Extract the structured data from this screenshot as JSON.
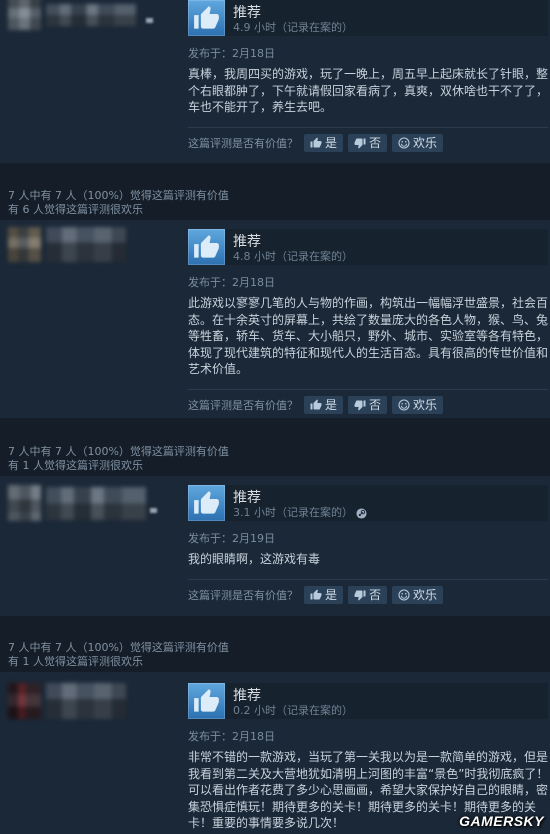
{
  "reviews": [
    {
      "recommendation": "推荐",
      "hours": "4.9 小时（记录在案的）",
      "posted": "发布于：2月18日",
      "body_lines": [
        "真棒，我周四买的游戏，玩了一晚上，周五早上起床就长了针眼，整",
        "个右眼都肿了，下午就请假回家看病了，真爽，双休啥也干不了了，",
        "车也不能开了，养生去吧。"
      ],
      "feedback": {
        "prompt": "这篇评测是否有价值？",
        "yes": "是",
        "no": "否",
        "funny": "欢乐"
      }
    },
    {
      "header": {
        "helpful": "7 人中有 7 人（100%）觉得这篇评测有价值",
        "funny": "有 6 人觉得这篇评测很欢乐"
      },
      "recommendation": "推荐",
      "hours": "4.8 小时（记录在案的）",
      "posted": "发布于：2月18日",
      "body_lines": [
        "此游戏以寥寥几笔的人与物的作画，构筑出一幅幅浮世盛景，社会百",
        "态。在十余英寸的屏幕上，共绘了数量庞大的各色人物，猴、鸟、兔",
        "等牲畜，轿车、货车、大小船只，野外、城市、实验室等各有特色，",
        "体现了现代建筑的特征和现代人的生活百态。具有很高的传世价值和",
        "艺术价值。"
      ],
      "feedback": {
        "prompt": "这篇评测是否有价值？",
        "yes": "是",
        "no": "否",
        "funny": "欢乐"
      }
    },
    {
      "header": {
        "helpful": "7 人中有 7 人（100%）觉得这篇评测有价值",
        "funny": "有 1 人觉得这篇评测很欢乐"
      },
      "recommendation": "推荐",
      "hours": "3.1 小时（记录在案的）",
      "platform_icon": "steam-icon",
      "posted": "发布于：2月19日",
      "body_lines": [
        "我的眼睛啊，这游戏有毒"
      ],
      "feedback": {
        "prompt": "这篇评测是否有价值？",
        "yes": "是",
        "no": "否",
        "funny": "欢乐"
      }
    },
    {
      "header": {
        "helpful": "7 人中有 7 人（100%）觉得这篇评测有价值",
        "funny": "有 1 人觉得这篇评测很欢乐"
      },
      "recommendation": "推荐",
      "hours": "0.2 小时（记录在案的）",
      "posted": "发布于：2月18日",
      "body_lines": [
        "非常不错的一款游戏，当玩了第一关我以为是一款简单的游戏，但是",
        "我看到第二关及大营地犹如清明上河图的丰富“景色”时我彻底疯了！",
        "可以看出作者花费了多少心思画画，希望大家保护好自己的眼睛，密",
        "集恐惧症慎玩！期待更多的关卡！期待更多的关卡！期待更多的关",
        "卡！重要的事情要多说几次！"
      ]
    }
  ],
  "icons": {
    "recommend": "thumbs-up-icon",
    "vote_yes": "thumbs-up-icon",
    "vote_no": "thumbs-down-icon",
    "vote_funny": "smiley-icon"
  },
  "watermark": "GAMERSKY",
  "colors": {
    "background": "#141d28",
    "card": "#1b2837",
    "accent": "#4f9bd8",
    "text": "#c8d2dc",
    "muted": "#8091a2",
    "button": "#2a4158"
  }
}
